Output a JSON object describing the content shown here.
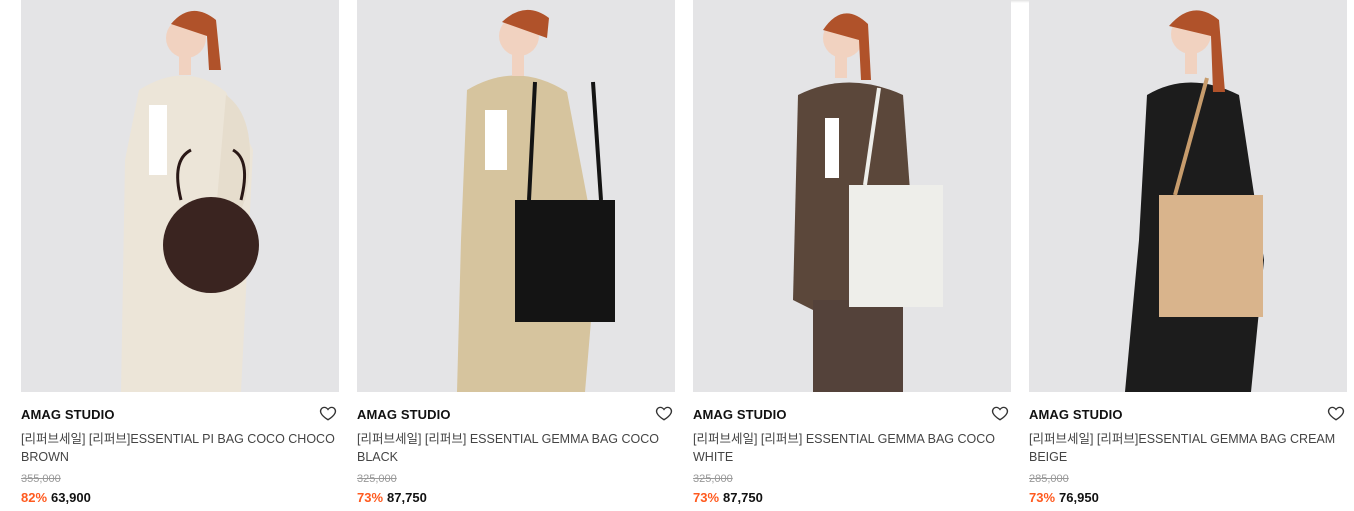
{
  "products": [
    {
      "brand": "AMAG STUDIO",
      "name": "[리퍼브세일] [리퍼브]ESSENTIAL PI BAG COCO CHOCO BROWN",
      "original_price": "355,000",
      "discount": "82%",
      "sale_price": "63,900",
      "image_alt": "model in cream boucle coat with round brown croc bag",
      "coat_color": "#ece5d8",
      "bag_color": "#3a2420"
    },
    {
      "brand": "AMAG STUDIO",
      "name": "[리퍼브세일] [리퍼브] ESSENTIAL GEMMA BAG COCO BLACK",
      "original_price": "325,000",
      "discount": "73%",
      "sale_price": "87,750",
      "image_alt": "model in beige trench coat with black croc tote",
      "coat_color": "#d6c49e",
      "bag_color": "#141414"
    },
    {
      "brand": "AMAG STUDIO",
      "name": "[리퍼브세일] [리퍼브] ESSENTIAL GEMMA BAG COCO WHITE",
      "original_price": "325,000",
      "discount": "73%",
      "sale_price": "87,750",
      "image_alt": "model in brown suit with white croc tote",
      "coat_color": "#5b473a",
      "bag_color": "#eeeeea"
    },
    {
      "brand": "AMAG STUDIO",
      "name": "[리퍼브세일] [리퍼브]ESSENTIAL GEMMA BAG CREAM BEIGE",
      "original_price": "285,000",
      "discount": "73%",
      "sale_price": "76,950",
      "image_alt": "model in black leather coat with cream beige tote",
      "coat_color": "#1c1c1c",
      "bag_color": "#d9b48c"
    }
  ],
  "colors": {
    "discount": "#ff5a1f",
    "photo_bg": "#e4e4e6"
  },
  "icons": {
    "wishlist": "heart-outline-icon"
  }
}
